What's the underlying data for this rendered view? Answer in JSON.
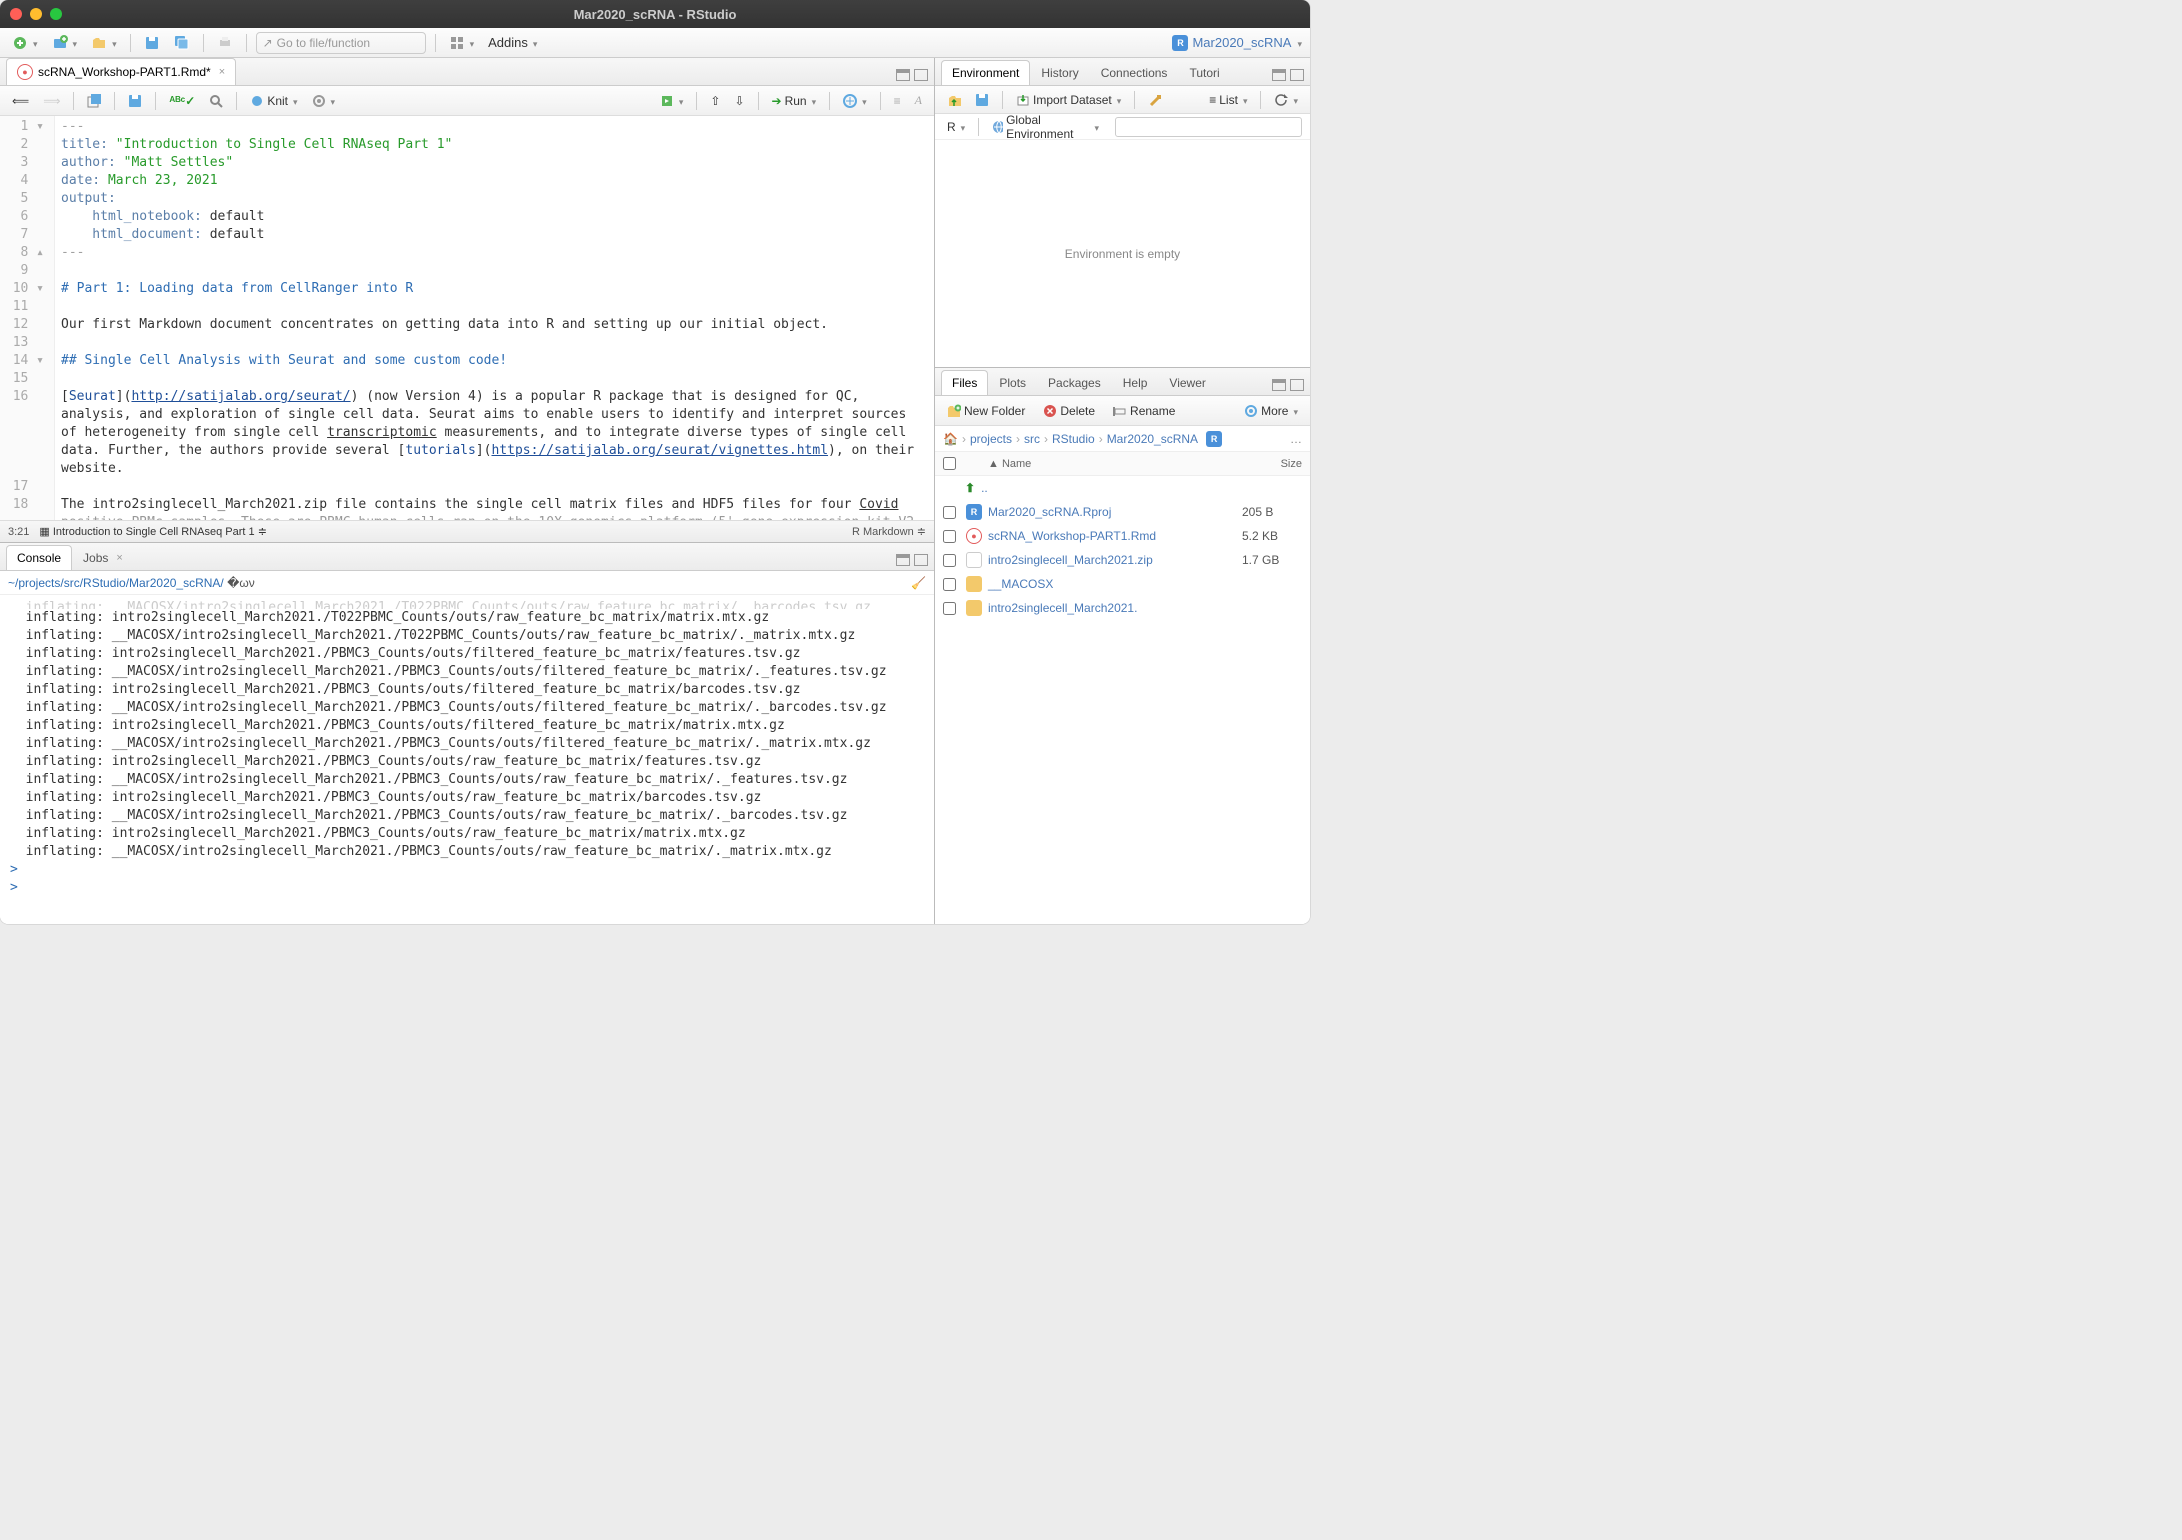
{
  "window": {
    "title": "Mar2020_scRNA - RStudio"
  },
  "main_toolbar": {
    "goto_placeholder": "Go to file/function",
    "addins": "Addins",
    "project": "Mar2020_scRNA"
  },
  "source": {
    "tab": "scRNA_Workshop-PART1.Rmd*",
    "knit": "Knit",
    "run": "Run",
    "gutter": [
      "1 ▾",
      "2  ",
      "3  ",
      "4  ",
      "5  ",
      "6  ",
      "7  ",
      "8 ▴",
      "9  ",
      "10 ▾",
      "11  ",
      "12  ",
      "13  ",
      "14 ▾",
      "15  ",
      "16  ",
      "   ",
      "   ",
      "   ",
      "   ",
      "17  ",
      "18  ",
      "   "
    ],
    "status_left": "3:21",
    "status_section": "Introduction to Single Cell RNAseq Part 1",
    "status_right": "R Markdown"
  },
  "console": {
    "tab1": "Console",
    "tab2": "Jobs",
    "path": "~/projects/src/RStudio/Mar2020_scRNA/",
    "lines": [
      "  inflating: intro2singlecell_March2021./T022PBMC_Counts/outs/raw_feature_bc_matrix/matrix.mtx.gz  ",
      "  inflating: __MACOSX/intro2singlecell_March2021./T022PBMC_Counts/outs/raw_feature_bc_matrix/._matrix.mtx.gz  ",
      "  inflating: intro2singlecell_March2021./PBMC3_Counts/outs/filtered_feature_bc_matrix/features.tsv.gz  ",
      "  inflating: __MACOSX/intro2singlecell_March2021./PBMC3_Counts/outs/filtered_feature_bc_matrix/._features.tsv.gz  ",
      "  inflating: intro2singlecell_March2021./PBMC3_Counts/outs/filtered_feature_bc_matrix/barcodes.tsv.gz  ",
      "  inflating: __MACOSX/intro2singlecell_March2021./PBMC3_Counts/outs/filtered_feature_bc_matrix/._barcodes.tsv.gz  ",
      "  inflating: intro2singlecell_March2021./PBMC3_Counts/outs/filtered_feature_bc_matrix/matrix.mtx.gz  ",
      "  inflating: __MACOSX/intro2singlecell_March2021./PBMC3_Counts/outs/filtered_feature_bc_matrix/._matrix.mtx.gz  ",
      "  inflating: intro2singlecell_March2021./PBMC3_Counts/outs/raw_feature_bc_matrix/features.tsv.gz  ",
      "  inflating: __MACOSX/intro2singlecell_March2021./PBMC3_Counts/outs/raw_feature_bc_matrix/._features.tsv.gz  ",
      "  inflating: intro2singlecell_March2021./PBMC3_Counts/outs/raw_feature_bc_matrix/barcodes.tsv.gz  ",
      "  inflating: __MACOSX/intro2singlecell_March2021./PBMC3_Counts/outs/raw_feature_bc_matrix/._barcodes.tsv.gz  ",
      "  inflating: intro2singlecell_March2021./PBMC3_Counts/outs/raw_feature_bc_matrix/matrix.mtx.gz  ",
      "  inflating: __MACOSX/intro2singlecell_March2021./PBMC3_Counts/outs/raw_feature_bc_matrix/._matrix.mtx.gz  "
    ]
  },
  "env": {
    "tab1": "Environment",
    "tab2": "History",
    "tab3": "Connections",
    "tab4": "Tutori",
    "import": "Import Dataset",
    "list": "List",
    "r": "R",
    "global": "Global Environment",
    "empty": "Environment is empty"
  },
  "files": {
    "tab1": "Files",
    "tab2": "Plots",
    "tab3": "Packages",
    "tab4": "Help",
    "tab5": "Viewer",
    "new_folder": "New Folder",
    "delete": "Delete",
    "rename": "Rename",
    "more": "More",
    "crumbs": [
      "projects",
      "src",
      "RStudio",
      "Mar2020_scRNA"
    ],
    "col_name": "Name",
    "col_size": "Size",
    "up": "..",
    "items": [
      {
        "name": "Mar2020_scRNA.Rproj",
        "size": "205 B",
        "icon": "r"
      },
      {
        "name": "scRNA_Workshop-PART1.Rmd",
        "size": "5.2 KB",
        "icon": "rmd"
      },
      {
        "name": "intro2singlecell_March2021.zip",
        "size": "1.7 GB",
        "icon": "file"
      },
      {
        "name": "__MACOSX",
        "size": "",
        "icon": "folder"
      },
      {
        "name": "intro2singlecell_March2021.",
        "size": "",
        "icon": "folder"
      }
    ]
  }
}
